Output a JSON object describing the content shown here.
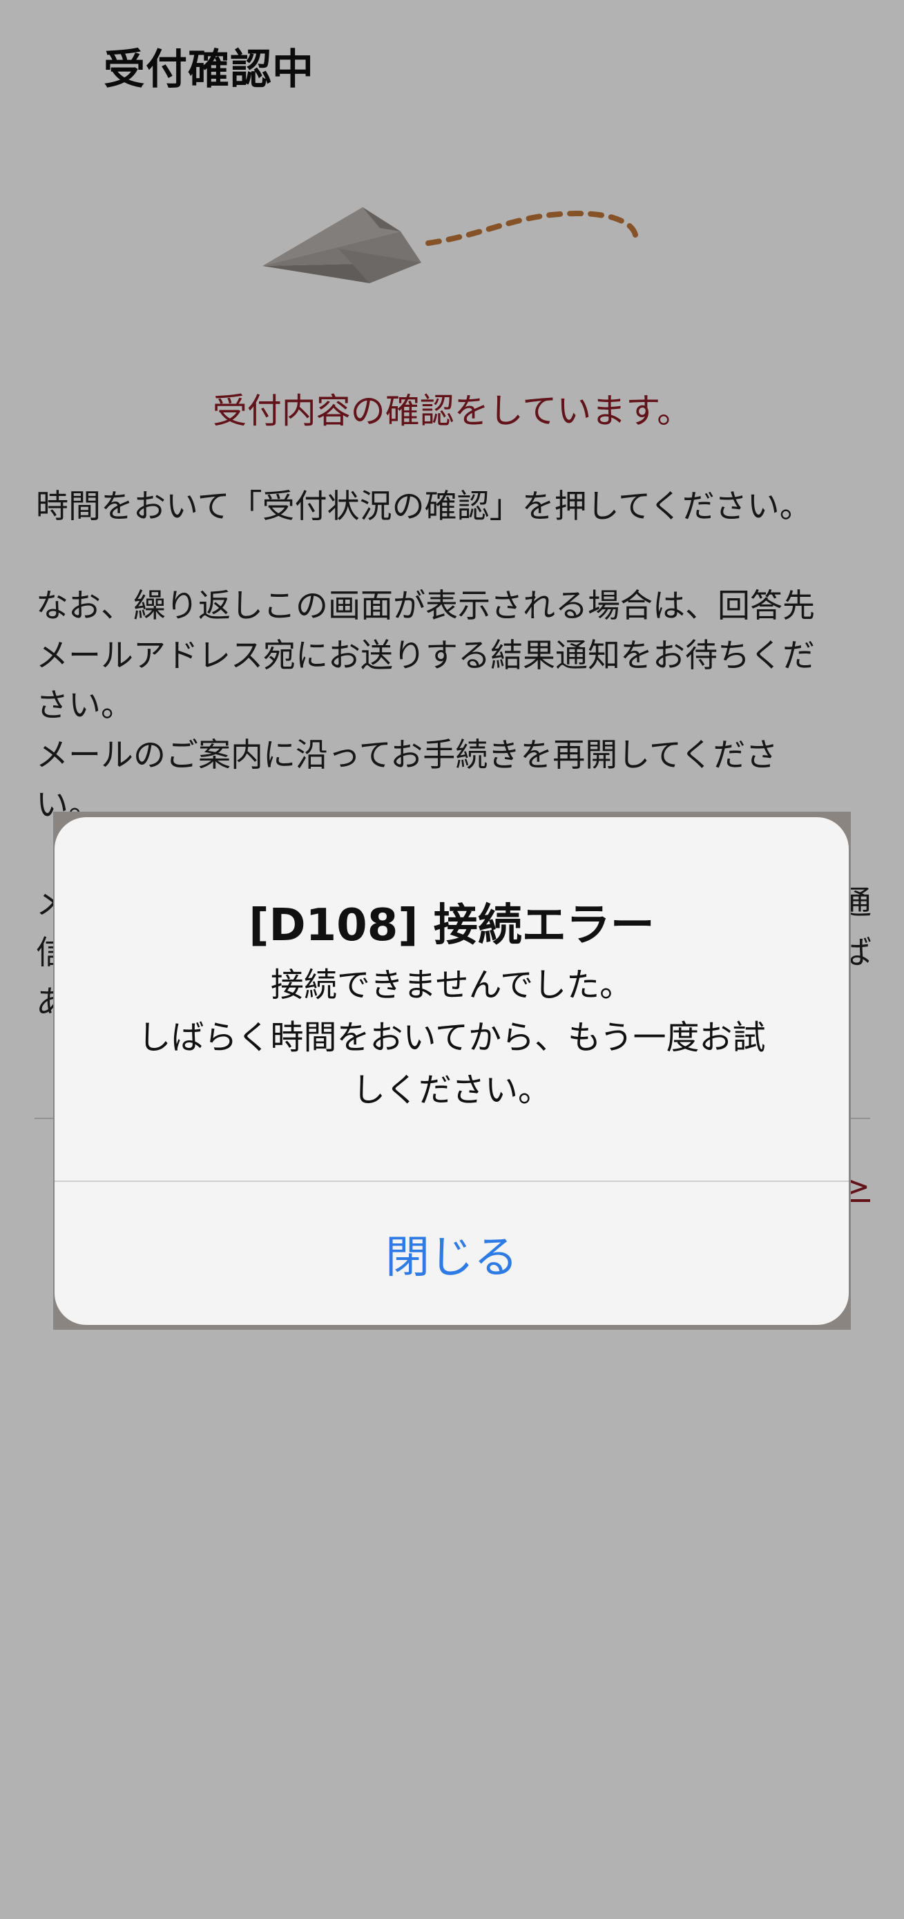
{
  "header": {
    "title": "受付確認中"
  },
  "status_message": "受付内容の確認をしています。",
  "body": {
    "paragraph1": "時間をおいて「受付状況の確認」を押してください。",
    "paragraph2_lines": [
      "なお、繰り返しこの画面が表示される場合は、回答先",
      "メールアドレス宛にお送りする結果通知をお待ちくだ",
      "さい。",
      "メールのご案内に沿ってお手続きを再開してくださ",
      "い。"
    ],
    "paragraph3_lines": [
      "メ",
      "信",
      "あ"
    ],
    "paragraph3_right_fragments": [
      "通",
      "ば"
    ],
    "link_fragment": ">"
  },
  "dialog": {
    "title": "[D108] 接続エラー",
    "message_lines": [
      "接続できませんでした。",
      "しばらく時間をおいてから、もう一度お試",
      "しください。"
    ],
    "close_button": "閉じる"
  },
  "colors": {
    "accent_red": "#8b1c24",
    "dialog_button_blue": "#2f7be6",
    "overlay": "rgba(0,0,0,0.30)",
    "trail_orange": "#c0783a"
  },
  "icons": {
    "illustration": "paper-airplane-icon"
  }
}
